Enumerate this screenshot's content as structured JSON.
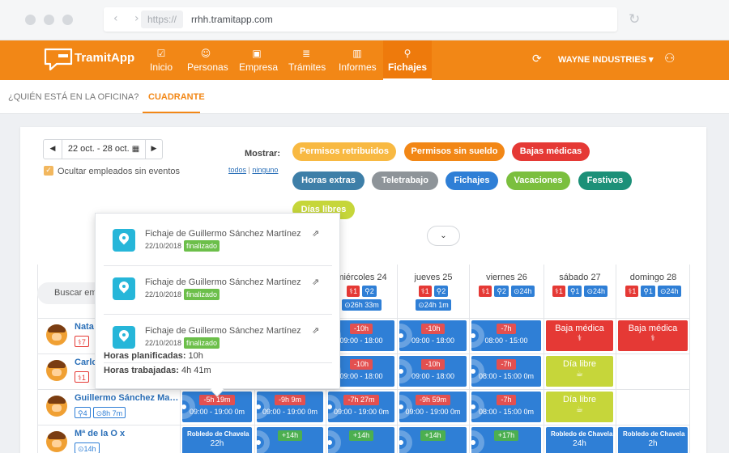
{
  "browser": {
    "nav_arrows": "‹ ›",
    "url_prefix": "https://",
    "url_host": "rrhh.tramitapp.com",
    "reload_icon": "↻"
  },
  "app": {
    "logo_text": "TramitApp",
    "menu": [
      {
        "label": "Inicio",
        "icon": "☑"
      },
      {
        "label": "Personas",
        "icon": "☺"
      },
      {
        "label": "Empresa",
        "icon": "▣"
      },
      {
        "label": "Trámites",
        "icon": "≣"
      },
      {
        "label": "Informes",
        "icon": "▥"
      },
      {
        "label": "Fichajes",
        "icon": "⚲",
        "active": true
      }
    ],
    "sync_icon": "⟳",
    "company": "WAYNE INDUSTRIES ▾",
    "user_icon": "⚇"
  },
  "subnav": {
    "tabs": [
      "¿QUIÉN ESTÁ EN LA OFICINA?",
      "CUADRANTE"
    ]
  },
  "controls": {
    "date_range": "22 oct. - 28 oct.",
    "calendar_icon": "▦",
    "prev_icon": "◀",
    "next_icon": "▶",
    "hide_without_events": "Ocultar empleados sin eventos",
    "check_icon": "✓",
    "show_label": "Mostrar:",
    "link_all": "todos",
    "link_separator": "|",
    "link_none": "ninguno",
    "expand_icon": "⌄",
    "search_placeholder": "Buscar em"
  },
  "filters": [
    {
      "label": "Permisos retribuidos",
      "color": "#f8b942"
    },
    {
      "label": "Permisos sin sueldo",
      "color": "#f28716"
    },
    {
      "label": "Bajas médicas",
      "color": "#e53935"
    },
    {
      "label": "Horas extras",
      "color": "#3e7fa8"
    },
    {
      "label": "Teletrabajo",
      "color": "#8e9499"
    },
    {
      "label": "Fichajes",
      "color": "#2f7fd6"
    },
    {
      "label": "Vacaciones",
      "color": "#7bbf3e"
    },
    {
      "label": "Festivos",
      "color": "#1c9078"
    },
    {
      "label": "Días libres",
      "color": "#c6d63a"
    }
  ],
  "days": [
    {
      "label": "miércoles 24",
      "tags": [
        [
          "r",
          "⚕1"
        ],
        [
          "b",
          "⚲2"
        ],
        [
          "b",
          "⊙26h 33m"
        ]
      ]
    },
    {
      "label": "jueves 25",
      "tags": [
        [
          "r",
          "⚕1"
        ],
        [
          "b",
          "⚲2"
        ],
        [
          "b",
          "⊙24h 1m"
        ]
      ]
    },
    {
      "label": "viernes 26",
      "tags": [
        [
          "r",
          "⚕1"
        ],
        [
          "b",
          "⚲2"
        ],
        [
          "b",
          "⊙24h"
        ]
      ]
    },
    {
      "label": "sábado 27",
      "tags": [
        [
          "r",
          "⚕1"
        ],
        [
          "b",
          "⚲1"
        ],
        [
          "b",
          "⊙24h"
        ]
      ]
    },
    {
      "label": "domingo 28",
      "tags": [
        [
          "r",
          "⚕1"
        ],
        [
          "b",
          "⚲1"
        ],
        [
          "b",
          "⊙24h"
        ]
      ]
    }
  ],
  "employees": [
    {
      "name": "Nata",
      "tags": [
        [
          "r",
          "⚕7"
        ]
      ]
    },
    {
      "name": "Carlo",
      "tags": [
        [
          "r",
          "⚕1"
        ]
      ]
    },
    {
      "name": "Guillermo Sánchez Martí…",
      "tags": [
        [
          "b",
          "⚲4"
        ],
        [
          "b",
          "⊙8h 7m"
        ]
      ]
    },
    {
      "name": "Mª de la O x",
      "tags": [
        [
          "b",
          "⊙14h"
        ]
      ]
    }
  ],
  "rows": [
    [
      {
        "type": "fichaje",
        "chip": "-10h",
        "chip_color": "red",
        "time": "09:00 - 18:00"
      },
      {
        "type": "fichaje",
        "chip": "-10h",
        "chip_color": "red",
        "time": "09:00 - 18:00"
      },
      {
        "type": "fichaje",
        "chip": "-7h",
        "chip_color": "red",
        "time": "08:00 - 15:00"
      },
      {
        "type": "baja",
        "title": "Baja médica",
        "glyph": "⚕"
      },
      {
        "type": "baja",
        "title": "Baja médica",
        "glyph": "⚕"
      }
    ],
    [
      {
        "type": "fichaje",
        "chip": "-10h",
        "chip_color": "red",
        "time": "09:00 - 18:00"
      },
      {
        "type": "fichaje",
        "chip": "-10h",
        "chip_color": "red",
        "time": "09:00 - 18:00"
      },
      {
        "type": "fichaje",
        "chip": "-7h",
        "chip_color": "red",
        "time": "08:00 - 15:00 0m"
      },
      {
        "type": "libre",
        "title": "Día libre",
        "glyph": "☕"
      },
      null
    ],
    [
      {
        "type": "fichaje",
        "chip": "-5h 19m",
        "chip_color": "red",
        "time": "09:00 - 19:00 0m"
      },
      {
        "type": "fichaje",
        "chip": "-9h 9m",
        "chip_color": "red",
        "time": "09:00 - 19:00 0m"
      },
      {
        "type": "fichaje",
        "chip": "-7h 27m",
        "chip_color": "red",
        "time": "09:00 - 19:00 0m"
      },
      {
        "type": "fichaje",
        "chip": "-9h 59m",
        "chip_color": "red",
        "time": "09:00 - 19:00 0m"
      },
      {
        "type": "fichaje",
        "chip": "-7h",
        "chip_color": "red",
        "time": "08:00 - 15:00 0m"
      },
      {
        "type": "libre",
        "title": "Día libre",
        "glyph": "☕"
      },
      null
    ],
    [
      {
        "type": "ext",
        "small": "Robledo de Chavela",
        "big": "22h"
      },
      {
        "type": "fichaje",
        "chip": "+14h",
        "chip_color": "green",
        "time": ""
      },
      {
        "type": "fichaje",
        "chip": "+14h",
        "chip_color": "green",
        "time": ""
      },
      {
        "type": "fichaje",
        "chip": "+14h",
        "chip_color": "green",
        "time": ""
      },
      {
        "type": "fichaje",
        "chip": "+17h",
        "chip_color": "green",
        "time": ""
      },
      {
        "type": "ext",
        "small": "Robledo de Chavela",
        "big": "24h"
      },
      {
        "type": "ext",
        "small": "Robledo de Chavela",
        "big": "2h"
      }
    ]
  ],
  "popover": {
    "items": [
      {
        "title": "Fichaje de Guillermo Sánchez Martínez",
        "date": "22/10/2018",
        "status": "finalizado"
      },
      {
        "title": "Fichaje de Guillermo Sánchez Martínez",
        "date": "22/10/2018",
        "status": "finalizado"
      },
      {
        "title": "Fichaje de Guillermo Sánchez Martínez",
        "date": "22/10/2018",
        "status": "finalizado"
      }
    ],
    "external_icon": "⇗",
    "planned_label": "Horas planificadas:",
    "planned_value": "10h",
    "worked_label": "Horas trabajadas:",
    "worked_value": "4h 41m"
  }
}
